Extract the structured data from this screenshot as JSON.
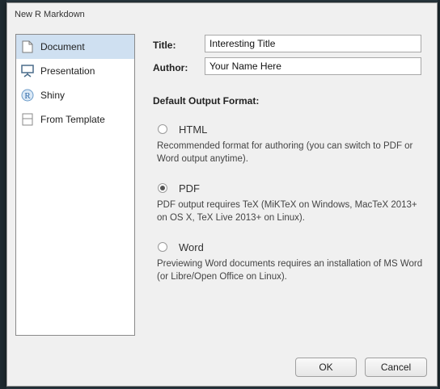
{
  "window": {
    "title": "New R Markdown"
  },
  "sidebar": {
    "items": [
      {
        "label": "Document",
        "icon": "document-icon",
        "selected": true
      },
      {
        "label": "Presentation",
        "icon": "presentation-icon",
        "selected": false
      },
      {
        "label": "Shiny",
        "icon": "shiny-r-icon",
        "selected": false
      },
      {
        "label": "From Template",
        "icon": "template-icon",
        "selected": false
      }
    ]
  },
  "form": {
    "title_label": "Title:",
    "title_value": "Interesting Title",
    "author_label": "Author:",
    "author_value": "Your Name Here"
  },
  "output": {
    "heading": "Default Output Format:",
    "formats": [
      {
        "label": "HTML",
        "checked": false,
        "description": "Recommended format for authoring (you can switch to PDF or Word output anytime)."
      },
      {
        "label": "PDF",
        "checked": true,
        "description": "PDF output requires TeX (MiKTeX on Windows, MacTeX 2013+ on OS X, TeX Live 2013+ on Linux)."
      },
      {
        "label": "Word",
        "checked": false,
        "description": "Previewing Word documents requires an installation of MS Word (or Libre/Open Office on Linux)."
      }
    ]
  },
  "buttons": {
    "ok": "OK",
    "cancel": "Cancel"
  },
  "colors": {
    "selected_bg": "#cfe0f1",
    "dialog_bg": "#f0f0f0",
    "background_ide": "#2b3a42"
  }
}
